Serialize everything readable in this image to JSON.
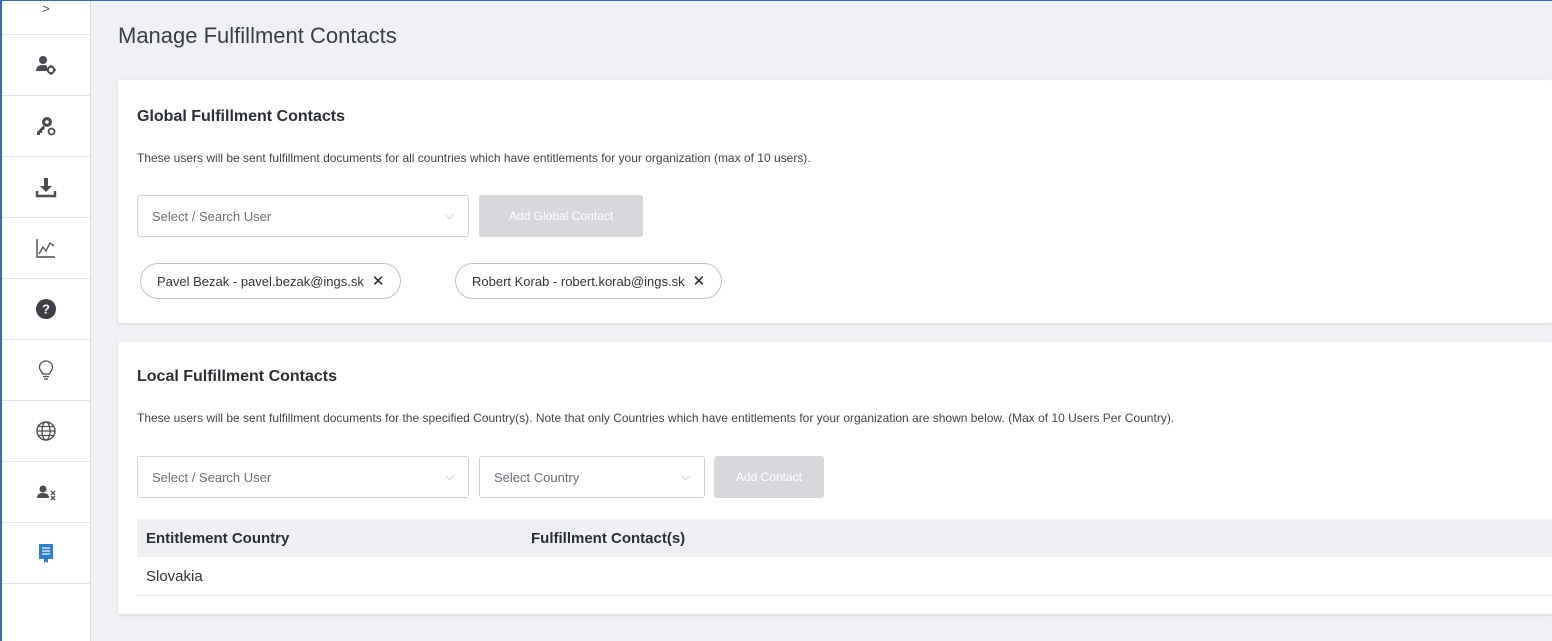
{
  "page": {
    "title": "Manage Fulfillment Contacts"
  },
  "sidebar": {
    "toggle": ">",
    "items": [
      {
        "icon": "user-settings-icon"
      },
      {
        "icon": "key-user-icon"
      },
      {
        "icon": "download-icon"
      },
      {
        "icon": "chart-icon"
      },
      {
        "icon": "help-icon"
      },
      {
        "icon": "lightbulb-icon"
      },
      {
        "icon": "globe-icon"
      },
      {
        "icon": "user-remove-icon"
      },
      {
        "icon": "certificate-icon",
        "active": true
      }
    ]
  },
  "global": {
    "title": "Global Fulfillment Contacts",
    "description": "These users will be sent fulfillment documents for all countries which have entitlements for your organization (max of 10 users).",
    "user_select_placeholder": "Select / Search User",
    "add_button": "Add Global Contact",
    "contacts": [
      "Pavel Bezak - pavel.bezak@ings.sk",
      "Robert Korab - robert.korab@ings.sk"
    ]
  },
  "local": {
    "title": "Local Fulfillment Contacts",
    "description": "These users will be sent fulfillment documents for the specified Country(s). Note that only Countries which have entitlements for your organization are shown below. (Max of 10 Users Per Country).",
    "user_select_placeholder": "Select / Search User",
    "country_select_placeholder": "Select Country",
    "add_button": "Add Contact",
    "table": {
      "headers": [
        "Entitlement Country",
        "Fulfillment Contact(s)"
      ],
      "rows": [
        {
          "country": "Slovakia",
          "contacts": ""
        }
      ]
    }
  },
  "colors": {
    "accent": "#2e6fc0",
    "disabled_button": "#d6d8dc",
    "background": "#f0f1f4"
  }
}
